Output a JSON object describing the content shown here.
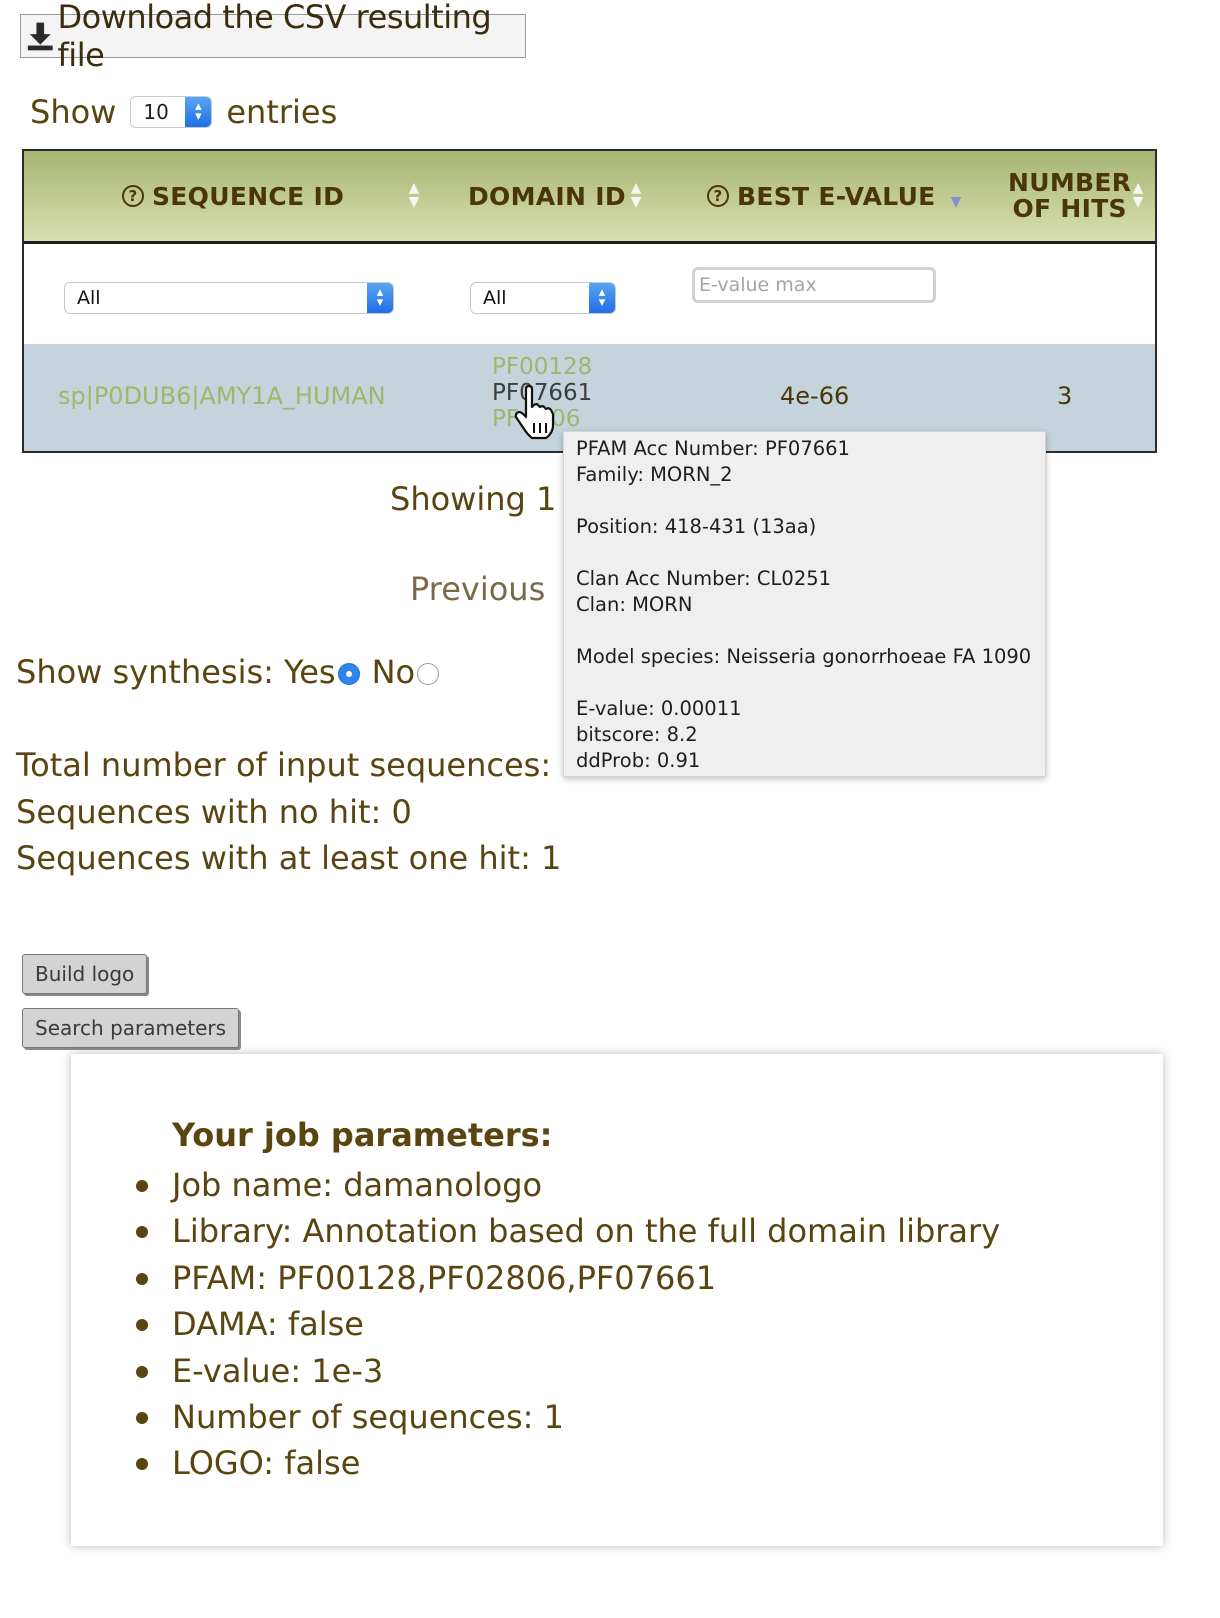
{
  "download": {
    "label": "Download the CSV resulting file"
  },
  "length_menu": {
    "prefix": "Show",
    "value": "10",
    "suffix": "entries"
  },
  "table": {
    "columns": [
      "SEQUENCE ID",
      "DOMAIN ID",
      "BEST E-VALUE",
      "NUMBER OF HITS"
    ],
    "columns_num_hits_lines": [
      "NUMBER",
      "OF HITS"
    ],
    "filters": {
      "sequence": "All",
      "domain": "All",
      "evalue_placeholder": "E-value max"
    },
    "rows": [
      {
        "sequence_id": "sp|P0DUB6|AMY1A_HUMAN",
        "domain_ids": [
          "PF00128",
          "PF07661",
          "PF02806"
        ],
        "domain_ids_visible": [
          "PF00128",
          "PF07661",
          "PF",
          "06"
        ],
        "best_evalue": "4e-66",
        "num_hits": "3"
      }
    ]
  },
  "tooltip": {
    "pfam_acc": "PFAM Acc Number: PF07661",
    "family": "Family: MORN_2",
    "position": "Position: 418-431 (13aa)",
    "clan_acc": "Clan Acc Number: CL0251",
    "clan": "Clan: MORN",
    "model_species": "Model species: Neisseria gonorrhoeae FA 1090",
    "evalue": "E-value: 0.00011",
    "bitscore": "bitscore: 8.2",
    "ddprob": "ddProb: 0.91"
  },
  "pagination": {
    "showing": "Showing 1 t",
    "previous": "Previous"
  },
  "synthesis": {
    "label": "Show synthesis:",
    "yes": "Yes",
    "no": "No",
    "selected": "Yes"
  },
  "stats": {
    "total": "Total number of input sequences: 1",
    "no_hit": "Sequences with no hit: 0",
    "at_least_one": "Sequences with at least one hit: 1"
  },
  "buttons": {
    "build_logo": "Build logo",
    "search_params": "Search parameters"
  },
  "params": {
    "title": "Your job parameters:",
    "items": [
      "Job name: damanologo",
      "Library: Annotation based on the full domain library",
      "PFAM: PF00128,PF02806,PF07661",
      "DAMA: false",
      "E-value: 1e-3",
      "Number of sequences: 1",
      "LOGO: false"
    ]
  },
  "colors": {
    "header_green": "#a6b572",
    "row_blue": "#c5d4dc",
    "link_green": "#9db86b",
    "text_brown": "#5a4410"
  }
}
